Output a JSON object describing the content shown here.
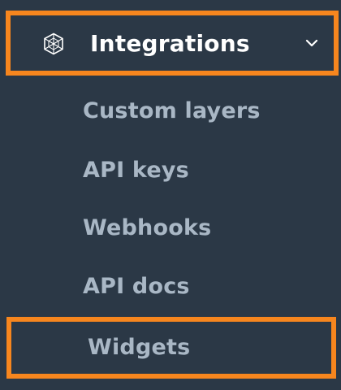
{
  "menu": {
    "parent": {
      "label": "Integrations",
      "icon": "hexagon-network-icon",
      "expanded_icon": "chevron-down-icon"
    },
    "items": [
      {
        "label": "Custom layers"
      },
      {
        "label": "API keys"
      },
      {
        "label": "Webhooks"
      },
      {
        "label": "API docs"
      },
      {
        "label": "Widgets"
      }
    ]
  },
  "colors": {
    "background": "#2b3846",
    "highlight": "#f7861e",
    "parent_text": "#ffffff",
    "child_text": "#a9b7c5"
  }
}
